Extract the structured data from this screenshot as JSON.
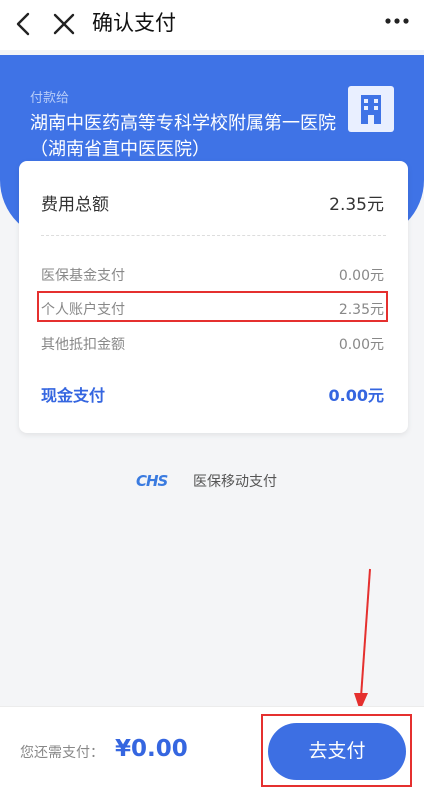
{
  "nav": {
    "title": "确认支付",
    "back_icon": "chevron-left-icon",
    "close_icon": "close-icon",
    "more_icon": "more-dots-icon"
  },
  "payee": {
    "label": "付款给",
    "name": "湖南中医药高等专科学校附属第一医院（湖南省直中医医院）",
    "icon": "building-icon"
  },
  "summary": {
    "total_label": "费用总额",
    "total_value": "2.35元",
    "rows": [
      {
        "label": "医保基金支付",
        "value": "0.00元"
      },
      {
        "label": "个人账户支付",
        "value": "2.35元"
      },
      {
        "label": "其他抵扣金额",
        "value": "0.00元"
      }
    ],
    "cash_label": "现金支付",
    "cash_value": "0.00元"
  },
  "brand": {
    "logo": "CHS",
    "text": "医保移动支付"
  },
  "footer": {
    "need_label": "您还需支付：",
    "amount": "¥0.00",
    "pay_button": "去支付"
  },
  "colors": {
    "accent": "#3d6fe3",
    "highlight": "#e5302f"
  }
}
